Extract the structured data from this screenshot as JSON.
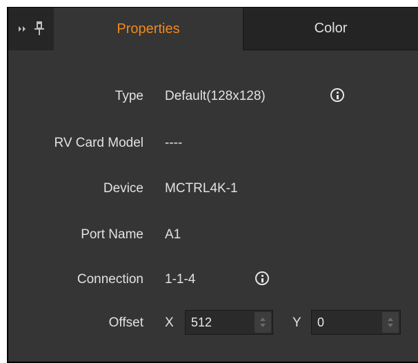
{
  "tabs": [
    {
      "label": "Properties",
      "active": true
    },
    {
      "label": "Color",
      "active": false
    }
  ],
  "header_icons": [
    "expand-arrows-icon",
    "pin-icon"
  ],
  "colors": {
    "panel_bg": "#353535",
    "tabbar_bg": "#262626",
    "active_tab_text": "#f08a1c",
    "text": "#e2e2e2",
    "input_bg": "#2a2a2a"
  },
  "properties": {
    "type": {
      "label": "Type",
      "value": "Default(128x128)"
    },
    "rv_card_model": {
      "label": "RV Card Model",
      "value": "----"
    },
    "device": {
      "label": "Device",
      "value": "MCTRL4K-1"
    },
    "port_name": {
      "label": "Port Name",
      "value": "A1"
    },
    "connection": {
      "label": "Connection",
      "value": "1-1-4"
    },
    "offset": {
      "label": "Offset",
      "x_label": "X",
      "x_value": "512",
      "y_label": "Y",
      "y_value": "0"
    }
  }
}
